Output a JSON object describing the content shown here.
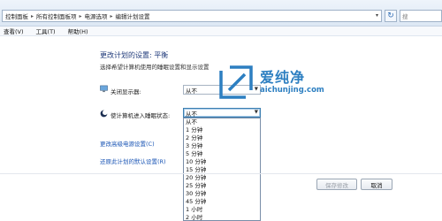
{
  "address_bar": {
    "crumbs": [
      "控制面板",
      "所有控制面板项",
      "电源选项",
      "编辑计划设置"
    ],
    "search_placeholder": "搜"
  },
  "menu": [
    "查看(V)",
    "工具(T)",
    "帮助(H)"
  ],
  "content": {
    "title": "更改计划的设置: 平衡",
    "description": "选择希望计算机使用的睡眠设置和显示设置",
    "display_label": "关闭显示器:",
    "display_value": "从不",
    "sleep_label": "使计算机进入睡眠状态:",
    "sleep_value": "从不",
    "sleep_options": [
      "从不",
      "1 分钟",
      "2 分钟",
      "3 分钟",
      "5 分钟",
      "10 分钟",
      "15 分钟",
      "20 分钟",
      "25 分钟",
      "30 分钟",
      "45 分钟",
      "1 小时",
      "2 小时"
    ],
    "advanced_link": "更改高级电源设置(C)",
    "restore_link": "还原此计划的默认设置(R)"
  },
  "buttons": {
    "save": "保存修改",
    "cancel": "取消"
  },
  "watermark": {
    "text": "爱纯净",
    "url": "aichunjing.com"
  },
  "colors": {
    "accent": "#2d7fc1",
    "link": "#1a55b5",
    "title": "#1f3a7a"
  }
}
